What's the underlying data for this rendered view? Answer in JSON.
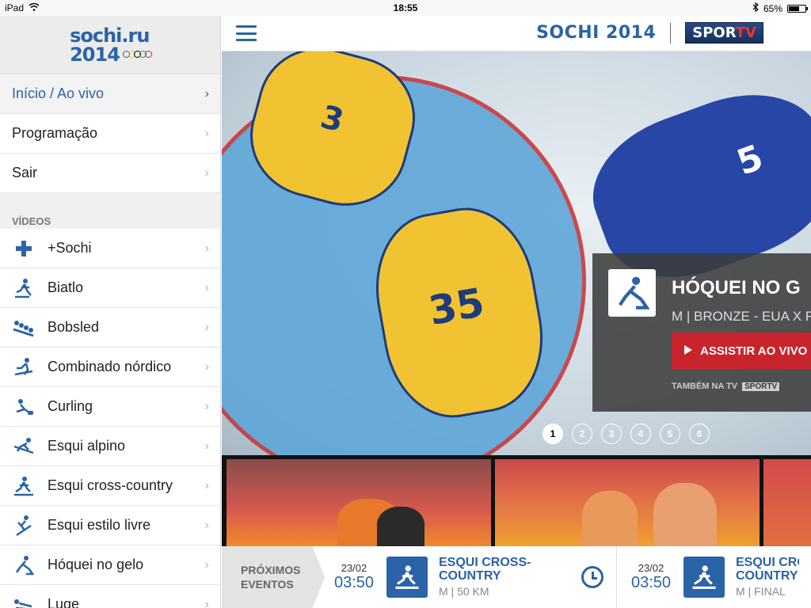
{
  "statusbar": {
    "device": "iPad",
    "time": "18:55",
    "battery": "65%",
    "battery_level": 0.65
  },
  "logo": {
    "line1": "sochi.ru",
    "line2": "2014"
  },
  "sidebar": {
    "menu": [
      {
        "label": "Início / Ao vivo",
        "active": true
      },
      {
        "label": "Programação",
        "active": false
      },
      {
        "label": "Sair",
        "active": false
      }
    ],
    "section_title": "VÍDEOS",
    "videos": [
      {
        "label": "+Sochi",
        "icon": "plus-icon"
      },
      {
        "label": "Biatlo",
        "icon": "biathlon-icon"
      },
      {
        "label": "Bobsled",
        "icon": "bobsled-icon"
      },
      {
        "label": "Combinado nórdico",
        "icon": "nordic-combined-icon"
      },
      {
        "label": "Curling",
        "icon": "curling-icon"
      },
      {
        "label": "Esqui alpino",
        "icon": "alpine-skiing-icon"
      },
      {
        "label": "Esqui cross-country",
        "icon": "cross-country-skiing-icon"
      },
      {
        "label": "Esqui estilo livre",
        "icon": "freestyle-skiing-icon"
      },
      {
        "label": "Hóquei no gelo",
        "icon": "ice-hockey-icon"
      },
      {
        "label": "Luge",
        "icon": "luge-icon"
      }
    ]
  },
  "header": {
    "title": "SOCHI 2014",
    "channel_a": "SPOR",
    "channel_b": "TV"
  },
  "hero": {
    "title": "HÓQUEI NO G",
    "subtitle": "M | BRONZE - EUA X F",
    "cta": "ASSISTIR AO VIVO",
    "tv_label": "TAMBÉM NA TV",
    "tv_channel": "SPORTV",
    "pages": [
      "1",
      "2",
      "3",
      "4",
      "5",
      "6"
    ],
    "jersey_a": "3",
    "jersey_b": "35",
    "jersey_c": "5"
  },
  "events": {
    "label_line1": "PRÓXIMOS",
    "label_line2": "EVENTOS",
    "items": [
      {
        "date": "23/02",
        "time": "03:50",
        "name_line1": "ESQUI CROSS-",
        "name_line2": "COUNTRY",
        "meta": "M | 50 KM"
      },
      {
        "date": "23/02",
        "time": "03:50",
        "name_line1": "ESQUI CROS",
        "name_line2": "COUNTRY",
        "meta": "M | FINAL"
      }
    ]
  },
  "colors": {
    "accent": "#2a63a8",
    "live": "#c8242b"
  }
}
